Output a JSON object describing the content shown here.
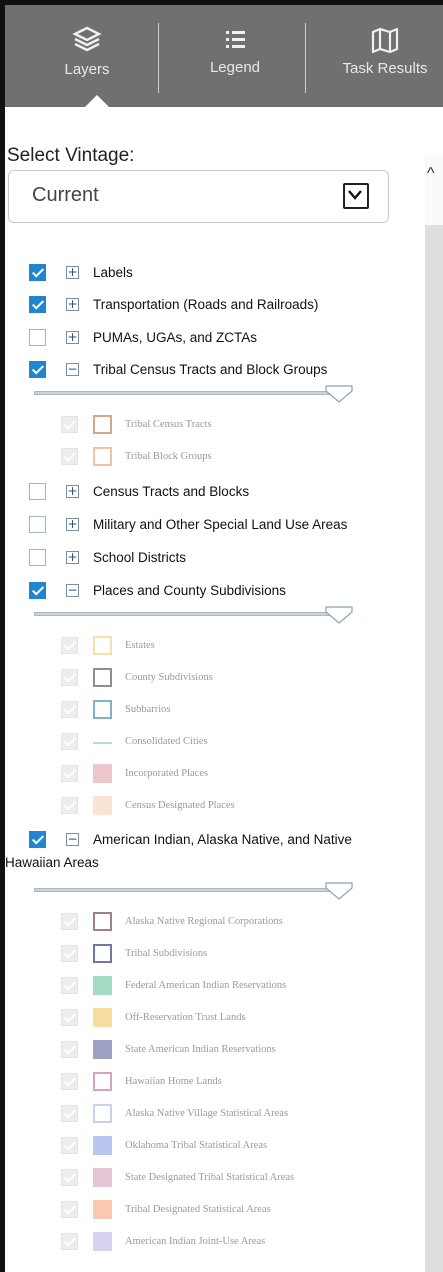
{
  "tabs": [
    {
      "label": "Layers",
      "icon": "layers-icon"
    },
    {
      "label": "Legend",
      "icon": "list-icon"
    },
    {
      "label": "Task Results",
      "icon": "map-icon"
    }
  ],
  "vintage": {
    "title": "Select Vintage:",
    "value": "Current"
  },
  "layers": {
    "labels": "Labels",
    "transportation": "Transportation (Roads and Railroads)",
    "pumas": "PUMAs, UGAs, and ZCTAs",
    "tribal": "Tribal Census Tracts and Block Groups",
    "census_tracts": "Census Tracts and Blocks",
    "military": "Military and Other Special Land Use Areas",
    "school": "School Districts",
    "places": "Places and County Subdivisions",
    "aian_line1": "American Indian, Alaska Native, and Native",
    "aian_line2": "Hawaiian Areas"
  },
  "tribal_subs": [
    "Tribal Census Tracts",
    "Tribal Block Groups"
  ],
  "places_subs": [
    "Estates",
    "County Subdivisions",
    "Subbarrios",
    "Consolidated Cities",
    "Incorporated Places",
    "Census Designated Places"
  ],
  "aian_subs": [
    "Alaska Native Regional Corporations",
    "Tribal Subdivisions",
    "Federal American Indian Reservations",
    "Off-Reservation Trust Lands",
    "State American Indian Reservations",
    "Hawaiian Home Lands",
    "Alaska Native Village Statistical Areas",
    "Oklahoma Tribal Statistical Areas",
    "State Designated Tribal Statistical Areas",
    "Tribal Designated Statistical Areas",
    "American Indian Joint-Use Areas"
  ],
  "colors": {
    "accent": "#1f86cf",
    "tabbar": "#707070"
  }
}
